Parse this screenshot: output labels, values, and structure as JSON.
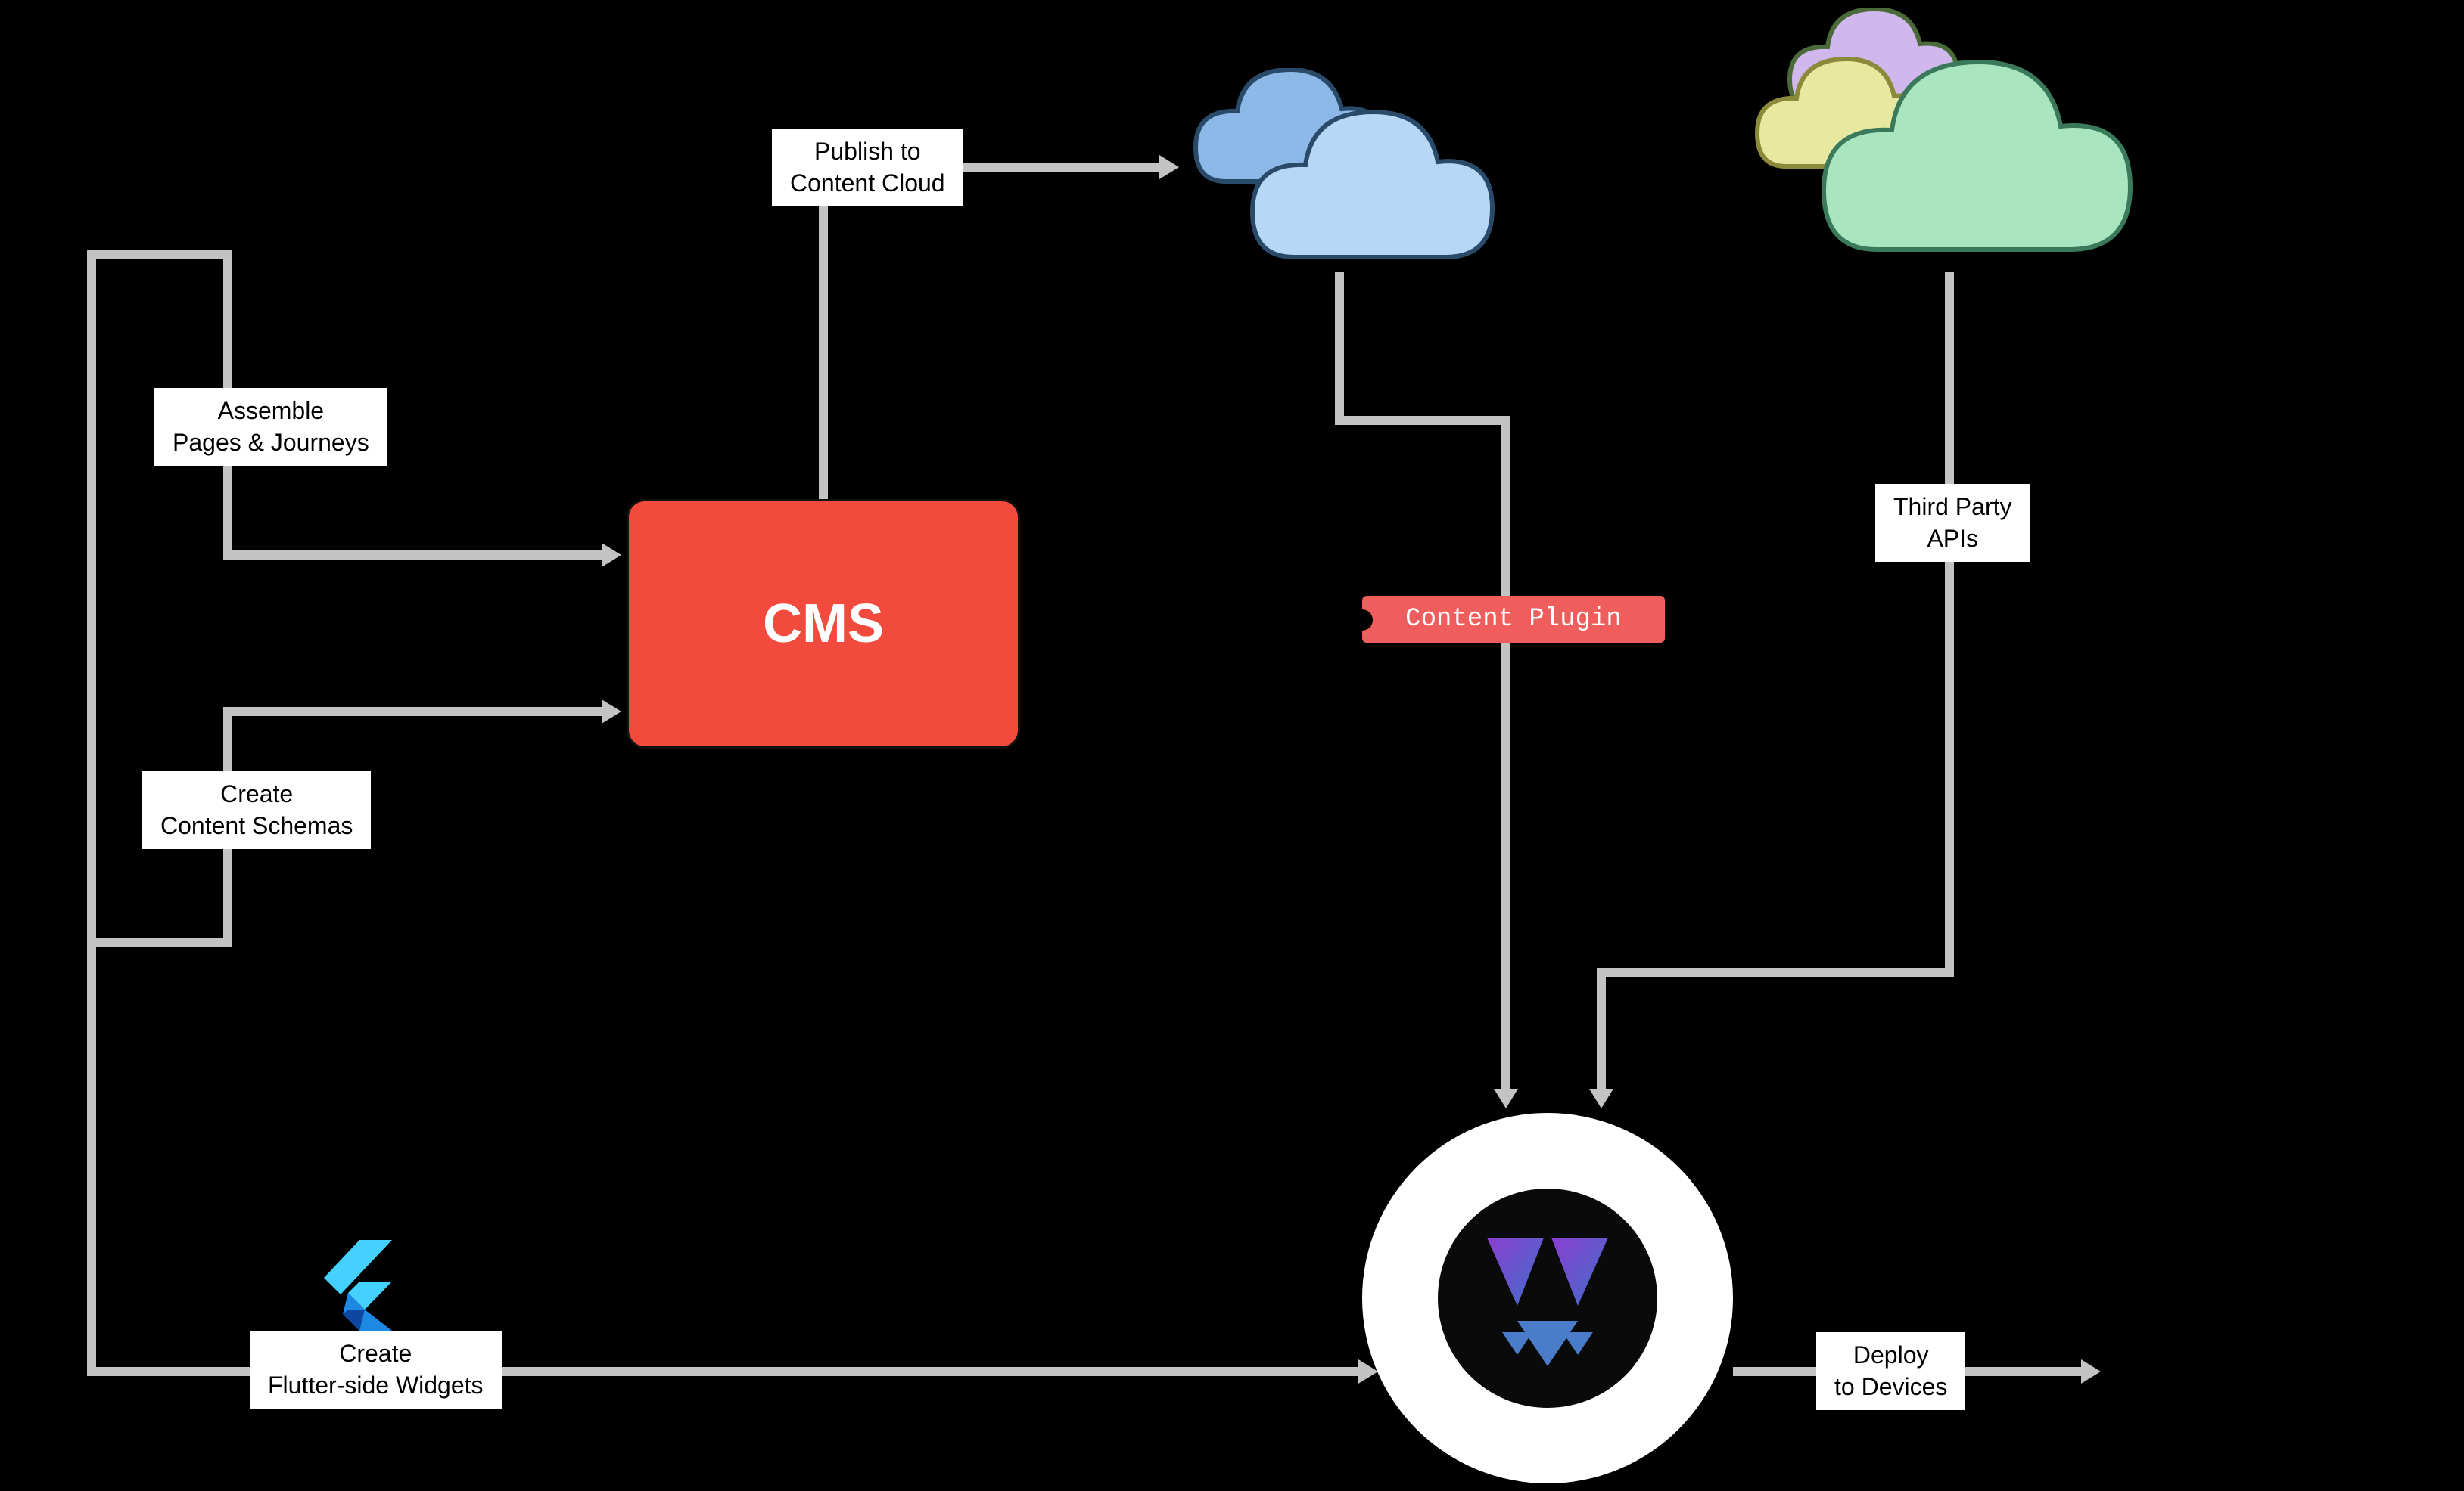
{
  "nodes": {
    "cms": "CMS",
    "content_plugin": "Content Plugin",
    "vyuh_logo": "vyuh-logo",
    "content_cloud": "content-cloud",
    "third_party_cloud": "third-party-cloud",
    "flutter": "flutter-icon"
  },
  "labels": {
    "assemble": "Assemble\nPages & Journeys",
    "create_schemas": "Create\nContent Schemas",
    "publish": "Publish to\nContent Cloud",
    "third_party_apis": "Third Party\nAPIs",
    "flutter_widgets": "Create\nFlutter-side Widgets",
    "deploy": "Deploy\nto Devices"
  },
  "colors": {
    "cms_bg": "#f24a3d",
    "plugin_bg": "#f05d5d",
    "connector": "#c3c3c3",
    "cloud_blue_light": "#b8d7f4",
    "cloud_blue_dark": "#8db9e8",
    "cloud_green": "#a9e6c0",
    "cloud_purple": "#d0b8ec",
    "cloud_yellow": "#e8e9a0",
    "vyuh_purple": "#6c3fb5",
    "vyuh_blue": "#4a7cc9"
  }
}
